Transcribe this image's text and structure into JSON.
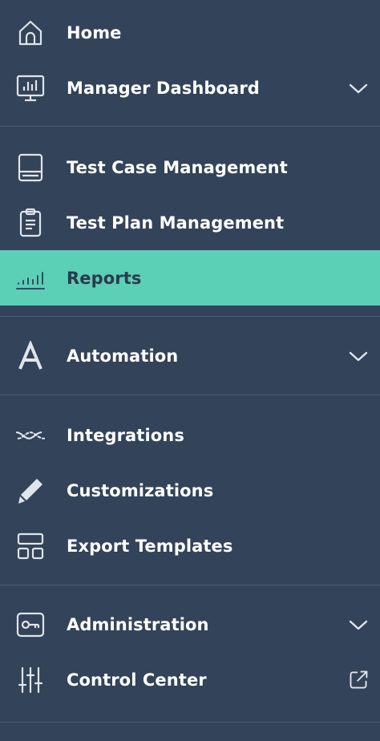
{
  "colors": {
    "sidebar_bg": "#334359",
    "active_bg": "#5ccfb7",
    "active_text": "#2b3a4e",
    "text": "#ffffff",
    "divider": "#4a5a70"
  },
  "nav": {
    "home": {
      "label": "Home",
      "icon": "home-icon"
    },
    "manager_dashboard": {
      "label": "Manager Dashboard",
      "icon": "dashboard-monitor-icon",
      "expandable": true
    },
    "test_case_management": {
      "label": "Test Case Management",
      "icon": "book-icon"
    },
    "test_plan_management": {
      "label": "Test Plan Management",
      "icon": "clipboard-icon"
    },
    "reports": {
      "label": "Reports",
      "icon": "reports-chart-icon",
      "active": true
    },
    "automation": {
      "label": "Automation",
      "icon": "automation-a-icon",
      "expandable": true
    },
    "integrations": {
      "label": "Integrations",
      "icon": "integrations-wave-icon"
    },
    "customizations": {
      "label": "Customizations",
      "icon": "pencil-icon"
    },
    "export_templates": {
      "label": "Export Templates",
      "icon": "templates-grid-icon"
    },
    "administration": {
      "label": "Administration",
      "icon": "key-icon",
      "expandable": true
    },
    "control_center": {
      "label": "Control Center",
      "icon": "sliders-icon",
      "external": true
    }
  }
}
